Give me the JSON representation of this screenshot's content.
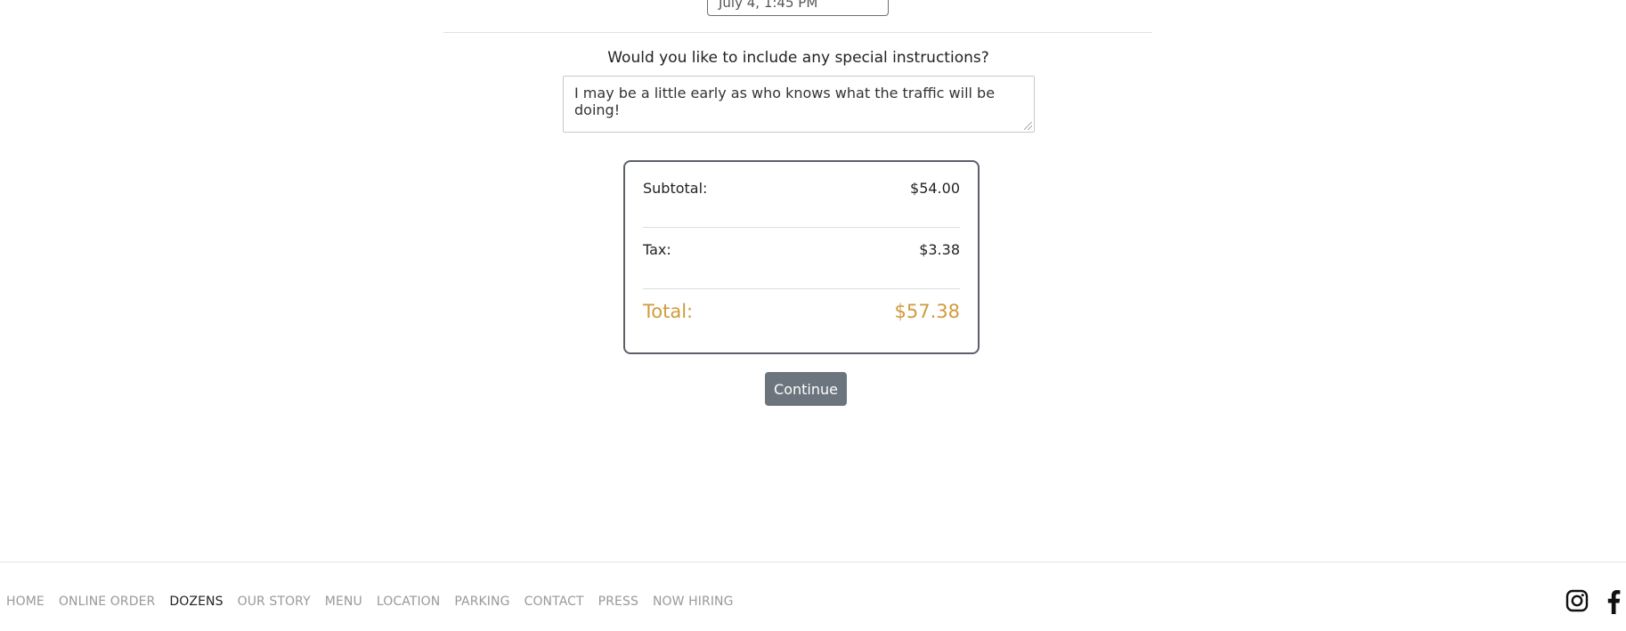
{
  "pickup": {
    "selected": "July 4, 1:45 PM"
  },
  "instructions": {
    "label": "Would you like to include any special instructions?",
    "value": "I may be a little early as who knows what the traffic will be doing!"
  },
  "summary": {
    "subtotal_label": "Subtotal:",
    "subtotal_value": "$54.00",
    "tax_label": "Tax:",
    "tax_value": "$3.38",
    "total_label": "Total:",
    "total_value": "$57.38",
    "accent_color": "#d09b3c"
  },
  "actions": {
    "continue_label": "Continue"
  },
  "footer": {
    "nav": [
      {
        "label": "HOME"
      },
      {
        "label": "ONLINE ORDER"
      },
      {
        "label": "DOZENS"
      },
      {
        "label": "OUR STORY"
      },
      {
        "label": "MENU"
      },
      {
        "label": "LOCATION"
      },
      {
        "label": "PARKING"
      },
      {
        "label": "CONTACT"
      },
      {
        "label": "PRESS"
      },
      {
        "label": "NOW HIRING"
      }
    ],
    "active": "DOZENS",
    "social_icons": [
      "instagram-icon",
      "facebook-icon"
    ]
  }
}
